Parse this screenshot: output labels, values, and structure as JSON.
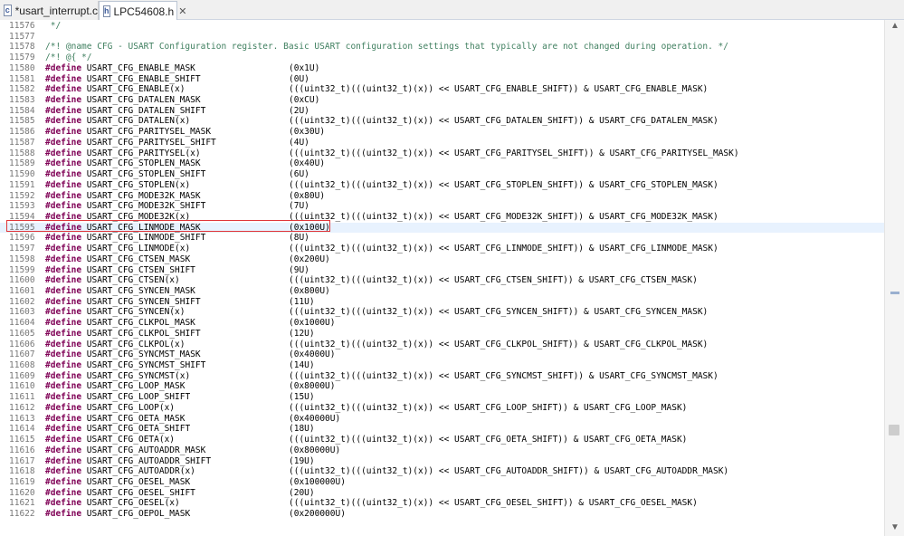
{
  "tabs": [
    {
      "label": "*usart_interrupt.c",
      "active": false
    },
    {
      "label": "LPC54608.h",
      "active": true
    }
  ],
  "editor": {
    "lines": [
      {
        "n": "11576",
        "t": "comment",
        "code": " */"
      },
      {
        "n": "11577",
        "t": "blank",
        "code": ""
      },
      {
        "n": "11578",
        "t": "comment",
        "code": "/*! @name CFG - USART Configuration register. Basic USART configuration settings that typically are not changed during operation. */"
      },
      {
        "n": "11579",
        "t": "comment",
        "code": "/*! @{ */"
      },
      {
        "n": "11580",
        "t": "define",
        "name": "USART_CFG_ENABLE_MASK",
        "value": "(0x1U)"
      },
      {
        "n": "11581",
        "t": "define",
        "name": "USART_CFG_ENABLE_SHIFT",
        "value": "(0U)"
      },
      {
        "n": "11582",
        "t": "define",
        "name": "USART_CFG_ENABLE(x)",
        "value": "(((uint32_t)(((uint32_t)(x)) << USART_CFG_ENABLE_SHIFT)) & USART_CFG_ENABLE_MASK)"
      },
      {
        "n": "11583",
        "t": "define",
        "name": "USART_CFG_DATALEN_MASK",
        "value": "(0xCU)"
      },
      {
        "n": "11584",
        "t": "define",
        "name": "USART_CFG_DATALEN_SHIFT",
        "value": "(2U)"
      },
      {
        "n": "11585",
        "t": "define",
        "name": "USART_CFG_DATALEN(x)",
        "value": "(((uint32_t)(((uint32_t)(x)) << USART_CFG_DATALEN_SHIFT)) & USART_CFG_DATALEN_MASK)"
      },
      {
        "n": "11586",
        "t": "define",
        "name": "USART_CFG_PARITYSEL_MASK",
        "value": "(0x30U)"
      },
      {
        "n": "11587",
        "t": "define",
        "name": "USART_CFG_PARITYSEL_SHIFT",
        "value": "(4U)"
      },
      {
        "n": "11588",
        "t": "define",
        "name": "USART_CFG_PARITYSEL(x)",
        "value": "(((uint32_t)(((uint32_t)(x)) << USART_CFG_PARITYSEL_SHIFT)) & USART_CFG_PARITYSEL_MASK)"
      },
      {
        "n": "11589",
        "t": "define",
        "name": "USART_CFG_STOPLEN_MASK",
        "value": "(0x40U)"
      },
      {
        "n": "11590",
        "t": "define",
        "name": "USART_CFG_STOPLEN_SHIFT",
        "value": "(6U)"
      },
      {
        "n": "11591",
        "t": "define",
        "name": "USART_CFG_STOPLEN(x)",
        "value": "(((uint32_t)(((uint32_t)(x)) << USART_CFG_STOPLEN_SHIFT)) & USART_CFG_STOPLEN_MASK)"
      },
      {
        "n": "11592",
        "t": "define",
        "name": "USART_CFG_MODE32K_MASK",
        "value": "(0x80U)"
      },
      {
        "n": "11593",
        "t": "define",
        "name": "USART_CFG_MODE32K_SHIFT",
        "value": "(7U)"
      },
      {
        "n": "11594",
        "t": "define",
        "name": "USART_CFG_MODE32K(x)",
        "value": "(((uint32_t)(((uint32_t)(x)) << USART_CFG_MODE32K_SHIFT)) & USART_CFG_MODE32K_MASK)"
      },
      {
        "n": "11595",
        "t": "define",
        "name": "USART_CFG_LINMODE_MASK",
        "value": "(0x100U)",
        "current": true
      },
      {
        "n": "11596",
        "t": "define",
        "name": "USART_CFG_LINMODE_SHIFT",
        "value": "(8U)"
      },
      {
        "n": "11597",
        "t": "define",
        "name": "USART_CFG_LINMODE(x)",
        "value": "(((uint32_t)(((uint32_t)(x)) << USART_CFG_LINMODE_SHIFT)) & USART_CFG_LINMODE_MASK)"
      },
      {
        "n": "11598",
        "t": "define",
        "name": "USART_CFG_CTSEN_MASK",
        "value": "(0x200U)"
      },
      {
        "n": "11599",
        "t": "define",
        "name": "USART_CFG_CTSEN_SHIFT",
        "value": "(9U)"
      },
      {
        "n": "11600",
        "t": "define",
        "name": "USART_CFG_CTSEN(x)",
        "value": "(((uint32_t)(((uint32_t)(x)) << USART_CFG_CTSEN_SHIFT)) & USART_CFG_CTSEN_MASK)"
      },
      {
        "n": "11601",
        "t": "define",
        "name": "USART_CFG_SYNCEN_MASK",
        "value": "(0x800U)"
      },
      {
        "n": "11602",
        "t": "define",
        "name": "USART_CFG_SYNCEN_SHIFT",
        "value": "(11U)"
      },
      {
        "n": "11603",
        "t": "define",
        "name": "USART_CFG_SYNCEN(x)",
        "value": "(((uint32_t)(((uint32_t)(x)) << USART_CFG_SYNCEN_SHIFT)) & USART_CFG_SYNCEN_MASK)"
      },
      {
        "n": "11604",
        "t": "define",
        "name": "USART_CFG_CLKPOL_MASK",
        "value": "(0x1000U)"
      },
      {
        "n": "11605",
        "t": "define",
        "name": "USART_CFG_CLKPOL_SHIFT",
        "value": "(12U)"
      },
      {
        "n": "11606",
        "t": "define",
        "name": "USART_CFG_CLKPOL(x)",
        "value": "(((uint32_t)(((uint32_t)(x)) << USART_CFG_CLKPOL_SHIFT)) & USART_CFG_CLKPOL_MASK)"
      },
      {
        "n": "11607",
        "t": "define",
        "name": "USART_CFG_SYNCMST_MASK",
        "value": "(0x4000U)"
      },
      {
        "n": "11608",
        "t": "define",
        "name": "USART_CFG_SYNCMST_SHIFT",
        "value": "(14U)"
      },
      {
        "n": "11609",
        "t": "define",
        "name": "USART_CFG_SYNCMST(x)",
        "value": "(((uint32_t)(((uint32_t)(x)) << USART_CFG_SYNCMST_SHIFT)) & USART_CFG_SYNCMST_MASK)"
      },
      {
        "n": "11610",
        "t": "define",
        "name": "USART_CFG_LOOP_MASK",
        "value": "(0x8000U)"
      },
      {
        "n": "11611",
        "t": "define",
        "name": "USART_CFG_LOOP_SHIFT",
        "value": "(15U)"
      },
      {
        "n": "11612",
        "t": "define",
        "name": "USART_CFG_LOOP(x)",
        "value": "(((uint32_t)(((uint32_t)(x)) << USART_CFG_LOOP_SHIFT)) & USART_CFG_LOOP_MASK)"
      },
      {
        "n": "11613",
        "t": "define",
        "name": "USART_CFG_OETA_MASK",
        "value": "(0x40000U)"
      },
      {
        "n": "11614",
        "t": "define",
        "name": "USART_CFG_OETA_SHIFT",
        "value": "(18U)"
      },
      {
        "n": "11615",
        "t": "define",
        "name": "USART_CFG_OETA(x)",
        "value": "(((uint32_t)(((uint32_t)(x)) << USART_CFG_OETA_SHIFT)) & USART_CFG_OETA_MASK)"
      },
      {
        "n": "11616",
        "t": "define",
        "name": "USART_CFG_AUTOADDR_MASK",
        "value": "(0x80000U)"
      },
      {
        "n": "11617",
        "t": "define",
        "name": "USART_CFG_AUTOADDR_SHIFT",
        "value": "(19U)"
      },
      {
        "n": "11618",
        "t": "define",
        "name": "USART_CFG_AUTOADDR(x)",
        "value": "(((uint32_t)(((uint32_t)(x)) << USART_CFG_AUTOADDR_SHIFT)) & USART_CFG_AUTOADDR_MASK)"
      },
      {
        "n": "11619",
        "t": "define",
        "name": "USART_CFG_OESEL_MASK",
        "value": "(0x100000U)"
      },
      {
        "n": "11620",
        "t": "define",
        "name": "USART_CFG_OESEL_SHIFT",
        "value": "(20U)"
      },
      {
        "n": "11621",
        "t": "define",
        "name": "USART_CFG_OESEL(x)",
        "value": "(((uint32_t)(((uint32_t)(x)) << USART_CFG_OESEL_SHIFT)) & USART_CFG_OESEL_MASK)"
      },
      {
        "n": "11622",
        "t": "define",
        "name": "USART_CFG_OEPOL_MASK",
        "value": "(0x200000U)"
      }
    ],
    "keyword": "#define"
  },
  "colors": {
    "keyword": "#7f0055",
    "comment": "#3f7f5f",
    "current_line": "#e8f2fe",
    "highlight_border": "#e0363a"
  },
  "icons": [
    "c-file-icon",
    "header-file-icon",
    "close-icon",
    "scroll-up-icon",
    "scroll-down-icon"
  ]
}
